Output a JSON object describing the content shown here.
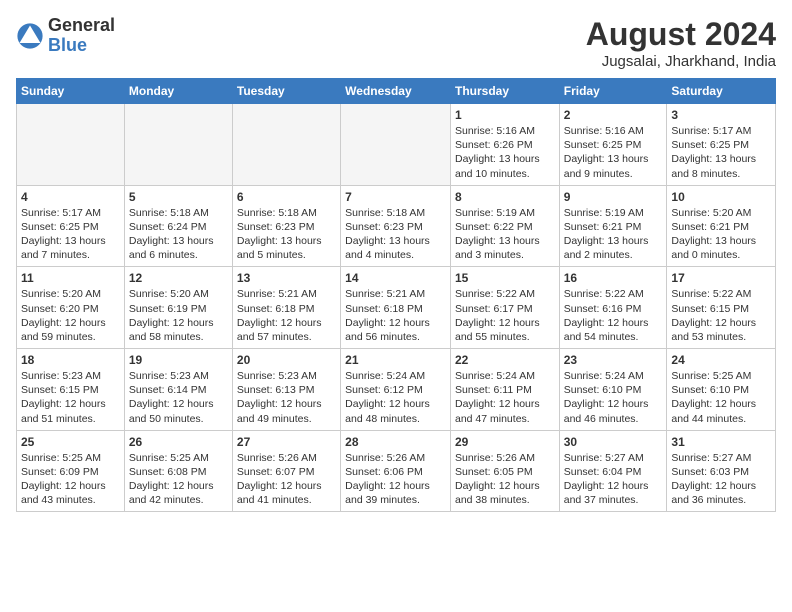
{
  "logo": {
    "general": "General",
    "blue": "Blue"
  },
  "title": "August 2024",
  "location": "Jugsalai, Jharkhand, India",
  "headers": [
    "Sunday",
    "Monday",
    "Tuesday",
    "Wednesday",
    "Thursday",
    "Friday",
    "Saturday"
  ],
  "weeks": [
    [
      {
        "day": "",
        "info": ""
      },
      {
        "day": "",
        "info": ""
      },
      {
        "day": "",
        "info": ""
      },
      {
        "day": "",
        "info": ""
      },
      {
        "day": "1",
        "info": "Sunrise: 5:16 AM\nSunset: 6:26 PM\nDaylight: 13 hours\nand 10 minutes."
      },
      {
        "day": "2",
        "info": "Sunrise: 5:16 AM\nSunset: 6:25 PM\nDaylight: 13 hours\nand 9 minutes."
      },
      {
        "day": "3",
        "info": "Sunrise: 5:17 AM\nSunset: 6:25 PM\nDaylight: 13 hours\nand 8 minutes."
      }
    ],
    [
      {
        "day": "4",
        "info": "Sunrise: 5:17 AM\nSunset: 6:25 PM\nDaylight: 13 hours\nand 7 minutes."
      },
      {
        "day": "5",
        "info": "Sunrise: 5:18 AM\nSunset: 6:24 PM\nDaylight: 13 hours\nand 6 minutes."
      },
      {
        "day": "6",
        "info": "Sunrise: 5:18 AM\nSunset: 6:23 PM\nDaylight: 13 hours\nand 5 minutes."
      },
      {
        "day": "7",
        "info": "Sunrise: 5:18 AM\nSunset: 6:23 PM\nDaylight: 13 hours\nand 4 minutes."
      },
      {
        "day": "8",
        "info": "Sunrise: 5:19 AM\nSunset: 6:22 PM\nDaylight: 13 hours\nand 3 minutes."
      },
      {
        "day": "9",
        "info": "Sunrise: 5:19 AM\nSunset: 6:21 PM\nDaylight: 13 hours\nand 2 minutes."
      },
      {
        "day": "10",
        "info": "Sunrise: 5:20 AM\nSunset: 6:21 PM\nDaylight: 13 hours\nand 0 minutes."
      }
    ],
    [
      {
        "day": "11",
        "info": "Sunrise: 5:20 AM\nSunset: 6:20 PM\nDaylight: 12 hours\nand 59 minutes."
      },
      {
        "day": "12",
        "info": "Sunrise: 5:20 AM\nSunset: 6:19 PM\nDaylight: 12 hours\nand 58 minutes."
      },
      {
        "day": "13",
        "info": "Sunrise: 5:21 AM\nSunset: 6:18 PM\nDaylight: 12 hours\nand 57 minutes."
      },
      {
        "day": "14",
        "info": "Sunrise: 5:21 AM\nSunset: 6:18 PM\nDaylight: 12 hours\nand 56 minutes."
      },
      {
        "day": "15",
        "info": "Sunrise: 5:22 AM\nSunset: 6:17 PM\nDaylight: 12 hours\nand 55 minutes."
      },
      {
        "day": "16",
        "info": "Sunrise: 5:22 AM\nSunset: 6:16 PM\nDaylight: 12 hours\nand 54 minutes."
      },
      {
        "day": "17",
        "info": "Sunrise: 5:22 AM\nSunset: 6:15 PM\nDaylight: 12 hours\nand 53 minutes."
      }
    ],
    [
      {
        "day": "18",
        "info": "Sunrise: 5:23 AM\nSunset: 6:15 PM\nDaylight: 12 hours\nand 51 minutes."
      },
      {
        "day": "19",
        "info": "Sunrise: 5:23 AM\nSunset: 6:14 PM\nDaylight: 12 hours\nand 50 minutes."
      },
      {
        "day": "20",
        "info": "Sunrise: 5:23 AM\nSunset: 6:13 PM\nDaylight: 12 hours\nand 49 minutes."
      },
      {
        "day": "21",
        "info": "Sunrise: 5:24 AM\nSunset: 6:12 PM\nDaylight: 12 hours\nand 48 minutes."
      },
      {
        "day": "22",
        "info": "Sunrise: 5:24 AM\nSunset: 6:11 PM\nDaylight: 12 hours\nand 47 minutes."
      },
      {
        "day": "23",
        "info": "Sunrise: 5:24 AM\nSunset: 6:10 PM\nDaylight: 12 hours\nand 46 minutes."
      },
      {
        "day": "24",
        "info": "Sunrise: 5:25 AM\nSunset: 6:10 PM\nDaylight: 12 hours\nand 44 minutes."
      }
    ],
    [
      {
        "day": "25",
        "info": "Sunrise: 5:25 AM\nSunset: 6:09 PM\nDaylight: 12 hours\nand 43 minutes."
      },
      {
        "day": "26",
        "info": "Sunrise: 5:25 AM\nSunset: 6:08 PM\nDaylight: 12 hours\nand 42 minutes."
      },
      {
        "day": "27",
        "info": "Sunrise: 5:26 AM\nSunset: 6:07 PM\nDaylight: 12 hours\nand 41 minutes."
      },
      {
        "day": "28",
        "info": "Sunrise: 5:26 AM\nSunset: 6:06 PM\nDaylight: 12 hours\nand 39 minutes."
      },
      {
        "day": "29",
        "info": "Sunrise: 5:26 AM\nSunset: 6:05 PM\nDaylight: 12 hours\nand 38 minutes."
      },
      {
        "day": "30",
        "info": "Sunrise: 5:27 AM\nSunset: 6:04 PM\nDaylight: 12 hours\nand 37 minutes."
      },
      {
        "day": "31",
        "info": "Sunrise: 5:27 AM\nSunset: 6:03 PM\nDaylight: 12 hours\nand 36 minutes."
      }
    ]
  ]
}
